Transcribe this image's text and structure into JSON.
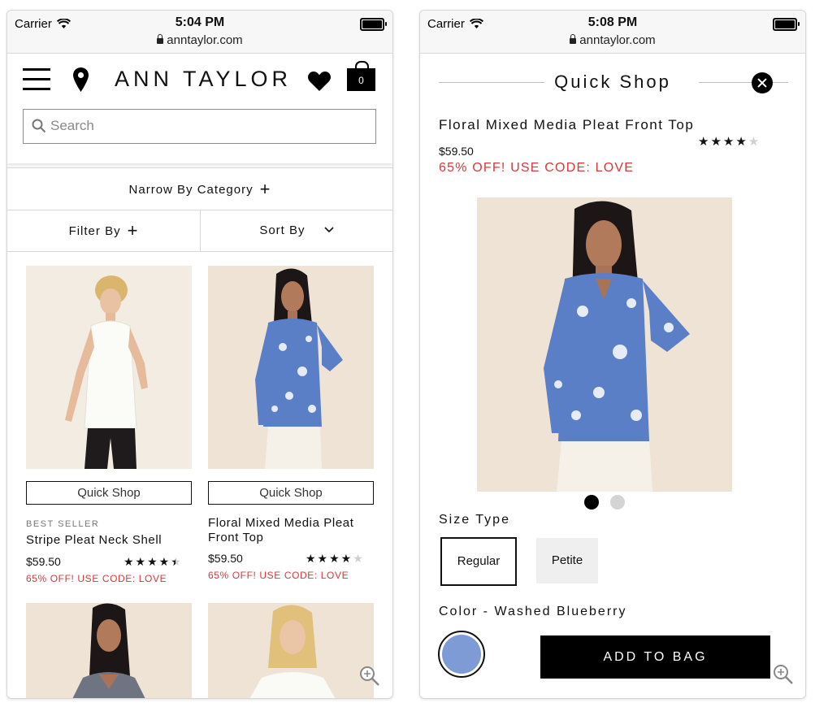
{
  "left": {
    "status": {
      "carrier": "Carrier",
      "time": "5:04 PM",
      "url": "anntaylor.com"
    },
    "header": {
      "logo": "ANN TAYLOR",
      "bag_count": "0",
      "search_placeholder": "Search"
    },
    "narrow_label": "Narrow By Category",
    "filter_label": "Filter By",
    "sort_label": "Sort By",
    "products": [
      {
        "quick_shop": "Quick Shop",
        "badge": "BEST SELLER",
        "name": "Stripe Pleat Neck Shell",
        "price": "$59.50",
        "promo": "65% OFF! USE CODE: LOVE",
        "rating": 4.5
      },
      {
        "quick_shop": "Quick Shop",
        "badge": "",
        "name": "Floral Mixed Media Pleat Front Top",
        "price": "$59.50",
        "promo": "65% OFF! USE CODE: LOVE",
        "rating": 4
      }
    ]
  },
  "right": {
    "status": {
      "carrier": "Carrier",
      "time": "5:08 PM",
      "url": "anntaylor.com"
    },
    "title": "Quick Shop",
    "product_name": "Floral Mixed Media Pleat Front Top",
    "price": "$59.50",
    "promo": "65% OFF! USE CODE: LOVE",
    "rating": 4,
    "size_type_label": "Size Type",
    "sizes": [
      "Regular",
      "Petite"
    ],
    "selected_size": "Regular",
    "color_label": "Color - Washed Blueberry",
    "add_to_bag": "ADD TO BAG"
  },
  "colors": {
    "promo_red": "#d9383a",
    "swatch_blue": "#7e9bd6",
    "top_blue": "#5b7fc7",
    "background_beige": "#efe3d6"
  },
  "icons": [
    "wifi-icon",
    "battery-icon",
    "lock-icon",
    "hamburger-icon",
    "location-pin-icon",
    "heart-icon",
    "shopping-bag-icon",
    "search-icon",
    "plus-icon",
    "chevron-down-icon",
    "close-icon",
    "zoom-icon"
  ]
}
